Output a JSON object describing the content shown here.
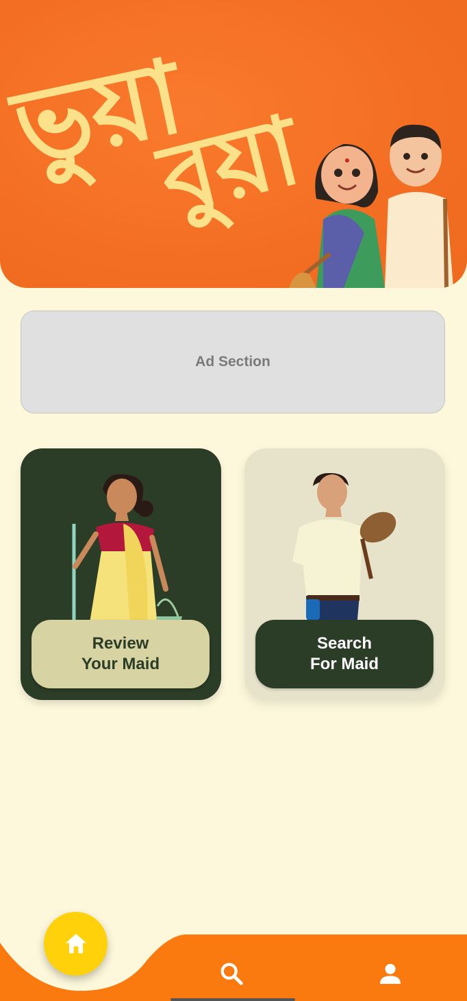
{
  "header": {
    "title_line1": "ভুয়া",
    "title_line2": "বুয়া",
    "background_color": "#f37024",
    "title_color": "#fbe28a"
  },
  "ad": {
    "label": "Ad Section"
  },
  "cards": [
    {
      "line1": "Review",
      "line2": "Your Maid",
      "bg": "#2b3c27",
      "button_bg": "#d8d3a3"
    },
    {
      "line1": "Search",
      "line2": "For Maid",
      "bg": "#e7e3ca",
      "button_bg": "#2b3c27"
    }
  ],
  "nav": {
    "items": [
      "home-icon",
      "search-icon",
      "profile-icon"
    ],
    "bar_color": "#fb7a10",
    "home_button_color": "#ffd10a"
  }
}
